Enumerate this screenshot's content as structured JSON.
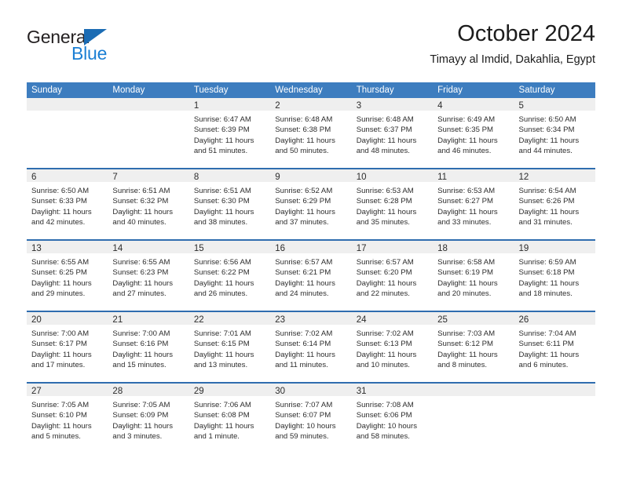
{
  "brand": {
    "line1": "General",
    "line2": "Blue",
    "accent_color": "#1b7fd4",
    "triangle_color": "#1b6cb4"
  },
  "header": {
    "title": "October 2024",
    "subtitle": "Timayy al Imdid, Dakahlia, Egypt"
  },
  "theme": {
    "header_row_bg": "#3d7dbf",
    "week_divider": "#2f6daf",
    "daynum_band_bg": "#efefef",
    "text_color": "#2d2d2d"
  },
  "weekdays": [
    "Sunday",
    "Monday",
    "Tuesday",
    "Wednesday",
    "Thursday",
    "Friday",
    "Saturday"
  ],
  "weeks": [
    [
      {
        "day": "",
        "sunrise": "",
        "sunset": "",
        "daylight": "",
        "empty": true
      },
      {
        "day": "",
        "sunrise": "",
        "sunset": "",
        "daylight": "",
        "empty": true
      },
      {
        "day": "1",
        "sunrise": "Sunrise: 6:47 AM",
        "sunset": "Sunset: 6:39 PM",
        "daylight": "Daylight: 11 hours and 51 minutes."
      },
      {
        "day": "2",
        "sunrise": "Sunrise: 6:48 AM",
        "sunset": "Sunset: 6:38 PM",
        "daylight": "Daylight: 11 hours and 50 minutes."
      },
      {
        "day": "3",
        "sunrise": "Sunrise: 6:48 AM",
        "sunset": "Sunset: 6:37 PM",
        "daylight": "Daylight: 11 hours and 48 minutes."
      },
      {
        "day": "4",
        "sunrise": "Sunrise: 6:49 AM",
        "sunset": "Sunset: 6:35 PM",
        "daylight": "Daylight: 11 hours and 46 minutes."
      },
      {
        "day": "5",
        "sunrise": "Sunrise: 6:50 AM",
        "sunset": "Sunset: 6:34 PM",
        "daylight": "Daylight: 11 hours and 44 minutes."
      }
    ],
    [
      {
        "day": "6",
        "sunrise": "Sunrise: 6:50 AM",
        "sunset": "Sunset: 6:33 PM",
        "daylight": "Daylight: 11 hours and 42 minutes."
      },
      {
        "day": "7",
        "sunrise": "Sunrise: 6:51 AM",
        "sunset": "Sunset: 6:32 PM",
        "daylight": "Daylight: 11 hours and 40 minutes."
      },
      {
        "day": "8",
        "sunrise": "Sunrise: 6:51 AM",
        "sunset": "Sunset: 6:30 PM",
        "daylight": "Daylight: 11 hours and 38 minutes."
      },
      {
        "day": "9",
        "sunrise": "Sunrise: 6:52 AM",
        "sunset": "Sunset: 6:29 PM",
        "daylight": "Daylight: 11 hours and 37 minutes."
      },
      {
        "day": "10",
        "sunrise": "Sunrise: 6:53 AM",
        "sunset": "Sunset: 6:28 PM",
        "daylight": "Daylight: 11 hours and 35 minutes."
      },
      {
        "day": "11",
        "sunrise": "Sunrise: 6:53 AM",
        "sunset": "Sunset: 6:27 PM",
        "daylight": "Daylight: 11 hours and 33 minutes."
      },
      {
        "day": "12",
        "sunrise": "Sunrise: 6:54 AM",
        "sunset": "Sunset: 6:26 PM",
        "daylight": "Daylight: 11 hours and 31 minutes."
      }
    ],
    [
      {
        "day": "13",
        "sunrise": "Sunrise: 6:55 AM",
        "sunset": "Sunset: 6:25 PM",
        "daylight": "Daylight: 11 hours and 29 minutes."
      },
      {
        "day": "14",
        "sunrise": "Sunrise: 6:55 AM",
        "sunset": "Sunset: 6:23 PM",
        "daylight": "Daylight: 11 hours and 27 minutes."
      },
      {
        "day": "15",
        "sunrise": "Sunrise: 6:56 AM",
        "sunset": "Sunset: 6:22 PM",
        "daylight": "Daylight: 11 hours and 26 minutes."
      },
      {
        "day": "16",
        "sunrise": "Sunrise: 6:57 AM",
        "sunset": "Sunset: 6:21 PM",
        "daylight": "Daylight: 11 hours and 24 minutes."
      },
      {
        "day": "17",
        "sunrise": "Sunrise: 6:57 AM",
        "sunset": "Sunset: 6:20 PM",
        "daylight": "Daylight: 11 hours and 22 minutes."
      },
      {
        "day": "18",
        "sunrise": "Sunrise: 6:58 AM",
        "sunset": "Sunset: 6:19 PM",
        "daylight": "Daylight: 11 hours and 20 minutes."
      },
      {
        "day": "19",
        "sunrise": "Sunrise: 6:59 AM",
        "sunset": "Sunset: 6:18 PM",
        "daylight": "Daylight: 11 hours and 18 minutes."
      }
    ],
    [
      {
        "day": "20",
        "sunrise": "Sunrise: 7:00 AM",
        "sunset": "Sunset: 6:17 PM",
        "daylight": "Daylight: 11 hours and 17 minutes."
      },
      {
        "day": "21",
        "sunrise": "Sunrise: 7:00 AM",
        "sunset": "Sunset: 6:16 PM",
        "daylight": "Daylight: 11 hours and 15 minutes."
      },
      {
        "day": "22",
        "sunrise": "Sunrise: 7:01 AM",
        "sunset": "Sunset: 6:15 PM",
        "daylight": "Daylight: 11 hours and 13 minutes."
      },
      {
        "day": "23",
        "sunrise": "Sunrise: 7:02 AM",
        "sunset": "Sunset: 6:14 PM",
        "daylight": "Daylight: 11 hours and 11 minutes."
      },
      {
        "day": "24",
        "sunrise": "Sunrise: 7:02 AM",
        "sunset": "Sunset: 6:13 PM",
        "daylight": "Daylight: 11 hours and 10 minutes."
      },
      {
        "day": "25",
        "sunrise": "Sunrise: 7:03 AM",
        "sunset": "Sunset: 6:12 PM",
        "daylight": "Daylight: 11 hours and 8 minutes."
      },
      {
        "day": "26",
        "sunrise": "Sunrise: 7:04 AM",
        "sunset": "Sunset: 6:11 PM",
        "daylight": "Daylight: 11 hours and 6 minutes."
      }
    ],
    [
      {
        "day": "27",
        "sunrise": "Sunrise: 7:05 AM",
        "sunset": "Sunset: 6:10 PM",
        "daylight": "Daylight: 11 hours and 5 minutes."
      },
      {
        "day": "28",
        "sunrise": "Sunrise: 7:05 AM",
        "sunset": "Sunset: 6:09 PM",
        "daylight": "Daylight: 11 hours and 3 minutes."
      },
      {
        "day": "29",
        "sunrise": "Sunrise: 7:06 AM",
        "sunset": "Sunset: 6:08 PM",
        "daylight": "Daylight: 11 hours and 1 minute."
      },
      {
        "day": "30",
        "sunrise": "Sunrise: 7:07 AM",
        "sunset": "Sunset: 6:07 PM",
        "daylight": "Daylight: 10 hours and 59 minutes."
      },
      {
        "day": "31",
        "sunrise": "Sunrise: 7:08 AM",
        "sunset": "Sunset: 6:06 PM",
        "daylight": "Daylight: 10 hours and 58 minutes."
      },
      {
        "day": "",
        "sunrise": "",
        "sunset": "",
        "daylight": "",
        "empty": true
      },
      {
        "day": "",
        "sunrise": "",
        "sunset": "",
        "daylight": "",
        "empty": true
      }
    ]
  ]
}
